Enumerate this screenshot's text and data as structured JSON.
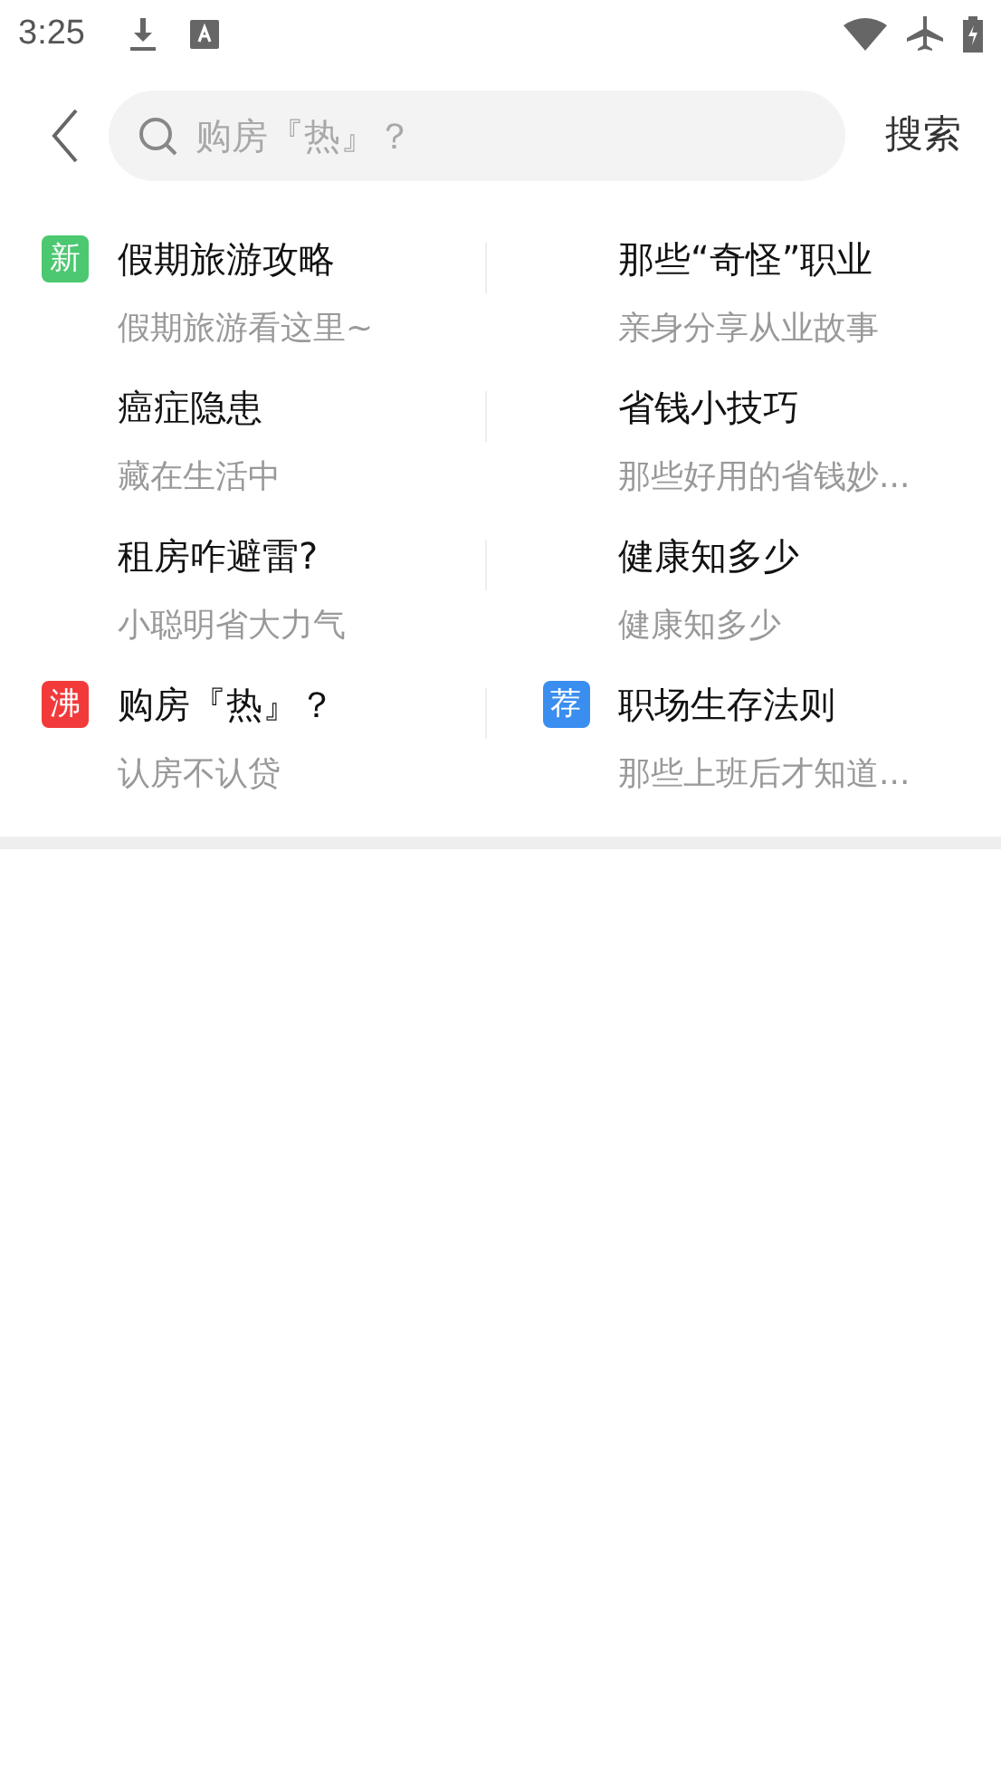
{
  "status_bar": {
    "time": "3:25"
  },
  "search": {
    "placeholder": "购房『热』？",
    "button": "搜索"
  },
  "topics": [
    {
      "title": "假期旅游攻略",
      "subtitle": "假期旅游看这里~",
      "badge": {
        "text": "新",
        "color": "#4cc870"
      }
    },
    {
      "title": "那些“奇怪”职业",
      "subtitle": "亲身分享从业故事"
    },
    {
      "title": "癌症隐患",
      "subtitle": "藏在生活中"
    },
    {
      "title": "省钱小技巧",
      "subtitle": "那些好用的省钱妙..."
    },
    {
      "title": "租房咋避雷?",
      "subtitle": "小聪明省大力气"
    },
    {
      "title": "健康知多少",
      "subtitle": "健康知多少"
    },
    {
      "title": "购房『热』？",
      "subtitle": "认房不认贷",
      "badge": {
        "text": "沸",
        "color": "#f23a3a"
      }
    },
    {
      "title": "职场生存法则",
      "subtitle": "那些上班后才知道...",
      "badge": {
        "text": "荐",
        "color": "#3a8ef0"
      }
    }
  ]
}
